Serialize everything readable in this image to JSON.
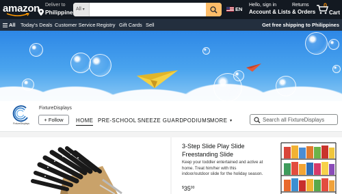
{
  "header": {
    "logo_text": "amazon",
    "deliver_label": "Deliver to",
    "deliver_location": "Philippines",
    "search_category": "All",
    "search_value": "",
    "language": "EN",
    "account_greeting": "Hello, sign in",
    "account_label": "Account & Lists",
    "returns_line1": "Returns",
    "returns_line2": "& Orders",
    "cart_count": "0",
    "cart_label": "Cart",
    "accent_color": "#febd69",
    "nav_bg": "#131921"
  },
  "subnav": {
    "all_label": "All",
    "items": [
      "Today's Deals",
      "Customer Service",
      "Registry",
      "Gift Cards",
      "Sell"
    ],
    "promo": "Get free shipping to Philippines"
  },
  "store": {
    "brand_name": "FixtureDisplays",
    "logo_caption": "FixtureDisplays",
    "follow_label": "+ Follow",
    "nav": [
      "HOME",
      "PRE-SCHOOL",
      "SNEEZE GUARD",
      "PODIUMS",
      "MORE"
    ],
    "active_nav": "HOME",
    "search_placeholder": "Search all FixtureDisplays"
  },
  "product": {
    "title": "3-Step Slide Play Slide Freestanding Slide",
    "description": "Keep your toddler entertained and active at home. Treat him/her with this indoor/outdoor slide for the holiday season.",
    "price_symbol": "$",
    "price_whole": "35",
    "price_cents": "00"
  }
}
